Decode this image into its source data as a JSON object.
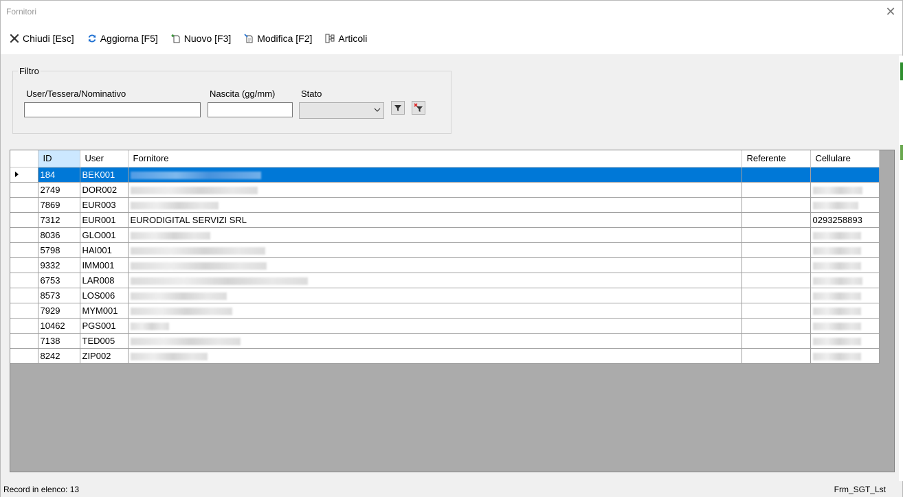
{
  "window": {
    "title": "Fornitori",
    "close_glyph": "✕"
  },
  "toolbar": {
    "items": [
      {
        "label": "Chiudi [Esc]",
        "icon": "close-icon"
      },
      {
        "label": "Aggiorna [F5]",
        "icon": "refresh-icon"
      },
      {
        "label": "Nuovo [F3]",
        "icon": "new-document-icon"
      },
      {
        "label": "Modifica [F2]",
        "icon": "edit-document-icon"
      },
      {
        "label": "Articoli",
        "icon": "articles-icon"
      }
    ]
  },
  "filter": {
    "legend": "Filtro",
    "user_label": "User/Tessera/Nominativo",
    "user_value": "",
    "birth_label": "Nascita (gg/mm)",
    "birth_value": "",
    "state_label": "Stato",
    "state_value": ""
  },
  "grid": {
    "columns": [
      "ID",
      "User",
      "Fornitore",
      "Referente",
      "Cellulare"
    ],
    "rows": [
      {
        "id": "184",
        "user": "BEK001",
        "fornitore": "",
        "referente": "",
        "cellulare": "",
        "selected": true,
        "blur_f": 190,
        "blur_c": 0
      },
      {
        "id": "2749",
        "user": "DOR002",
        "fornitore": "",
        "referente": "",
        "cellulare": "",
        "selected": false,
        "blur_f": 185,
        "blur_c": 72
      },
      {
        "id": "7869",
        "user": "EUR003",
        "fornitore": "",
        "referente": "",
        "cellulare": "",
        "selected": false,
        "blur_f": 128,
        "blur_c": 66
      },
      {
        "id": "7312",
        "user": "EUR001",
        "fornitore": "EURODIGITAL SERVIZI SRL",
        "referente": "",
        "cellulare": "0293258893",
        "selected": false,
        "blur_f": 0,
        "blur_c": 0
      },
      {
        "id": "8036",
        "user": "GLO001",
        "fornitore": "",
        "referente": "",
        "cellulare": "",
        "selected": false,
        "blur_f": 116,
        "blur_c": 70
      },
      {
        "id": "5798",
        "user": "HAI001",
        "fornitore": "",
        "referente": "",
        "cellulare": "",
        "selected": false,
        "blur_f": 196,
        "blur_c": 70
      },
      {
        "id": "9332",
        "user": "IMM001",
        "fornitore": "",
        "referente": "",
        "cellulare": "",
        "selected": false,
        "blur_f": 198,
        "blur_c": 70
      },
      {
        "id": "6753",
        "user": "LAR008",
        "fornitore": "",
        "referente": "",
        "cellulare": "",
        "selected": false,
        "blur_f": 258,
        "blur_c": 72
      },
      {
        "id": "8573",
        "user": "LOS006",
        "fornitore": "",
        "referente": "",
        "cellulare": "",
        "selected": false,
        "blur_f": 140,
        "blur_c": 70
      },
      {
        "id": "7929",
        "user": "MYM001",
        "fornitore": "",
        "referente": "",
        "cellulare": "",
        "selected": false,
        "blur_f": 148,
        "blur_c": 70
      },
      {
        "id": "10462",
        "user": "PGS001",
        "fornitore": "",
        "referente": "",
        "cellulare": "",
        "selected": false,
        "blur_f": 56,
        "blur_c": 70
      },
      {
        "id": "7138",
        "user": "TED005",
        "fornitore": "",
        "referente": "",
        "cellulare": "",
        "selected": false,
        "blur_f": 160,
        "blur_c": 70
      },
      {
        "id": "8242",
        "user": "ZIP002",
        "fornitore": "",
        "referente": "",
        "cellulare": "",
        "selected": false,
        "blur_f": 112,
        "blur_c": 70
      }
    ]
  },
  "status": {
    "records": "Record in elenco: 13",
    "form_name": "Frm_SGT_Lst"
  },
  "colors": {
    "selection": "#0078d7",
    "header_selected": "#cce8ff",
    "grid_background": "#ababab"
  }
}
